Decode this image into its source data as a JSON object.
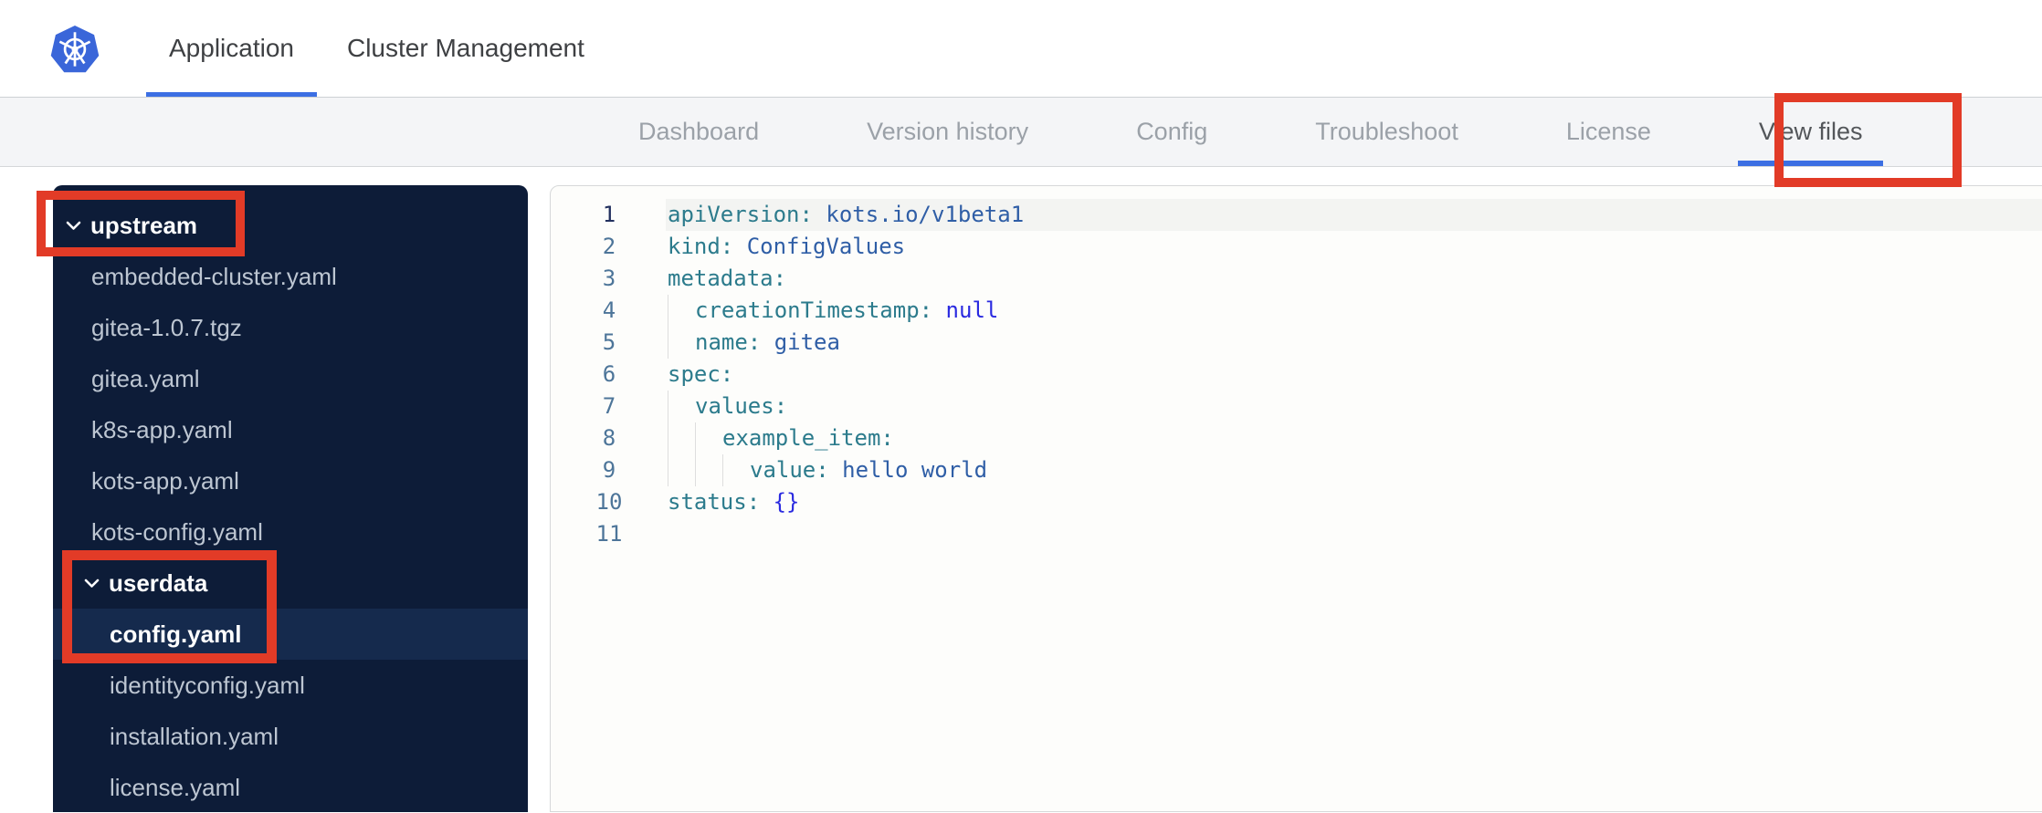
{
  "top_nav": {
    "tabs": [
      {
        "label": "Application",
        "active": true
      },
      {
        "label": "Cluster Management",
        "active": false
      }
    ]
  },
  "app_nav": {
    "tabs": [
      "Dashboard",
      "Version history",
      "Config",
      "Troubleshoot",
      "License",
      "View files"
    ],
    "active_tab": "View files"
  },
  "sidebar": {
    "items": [
      {
        "kind": "folder",
        "label": "upstream",
        "level": 0,
        "expanded": true
      },
      {
        "kind": "file",
        "label": "embedded-cluster.yaml",
        "level": 1
      },
      {
        "kind": "file",
        "label": "gitea-1.0.7.tgz",
        "level": 1
      },
      {
        "kind": "file",
        "label": "gitea.yaml",
        "level": 1
      },
      {
        "kind": "file",
        "label": "k8s-app.yaml",
        "level": 1
      },
      {
        "kind": "file",
        "label": "kots-app.yaml",
        "level": 1
      },
      {
        "kind": "file",
        "label": "kots-config.yaml",
        "level": 1
      },
      {
        "kind": "folder",
        "label": "userdata",
        "level": 1,
        "expanded": true
      },
      {
        "kind": "file",
        "label": "config.yaml",
        "level": 2,
        "selected": true
      },
      {
        "kind": "file",
        "label": "identityconfig.yaml",
        "level": 2
      },
      {
        "kind": "file",
        "label": "installation.yaml",
        "level": 2
      },
      {
        "kind": "file",
        "label": "license.yaml",
        "level": 2
      }
    ]
  },
  "editor": {
    "language": "yaml",
    "lines": [
      {
        "n": 1,
        "active": true,
        "indent": 0,
        "tokens": [
          [
            "key",
            "apiVersion:"
          ],
          [
            "sp",
            " "
          ],
          [
            "val",
            "kots.io/v1beta1"
          ]
        ]
      },
      {
        "n": 2,
        "indent": 0,
        "tokens": [
          [
            "key",
            "kind:"
          ],
          [
            "sp",
            " "
          ],
          [
            "val",
            "ConfigValues"
          ]
        ]
      },
      {
        "n": 3,
        "indent": 0,
        "tokens": [
          [
            "key",
            "metadata:"
          ]
        ]
      },
      {
        "n": 4,
        "indent": 1,
        "tokens": [
          [
            "key",
            "creationTimestamp:"
          ],
          [
            "sp",
            " "
          ],
          [
            "kw",
            "null"
          ]
        ]
      },
      {
        "n": 5,
        "indent": 1,
        "tokens": [
          [
            "key",
            "name:"
          ],
          [
            "sp",
            " "
          ],
          [
            "val",
            "gitea"
          ]
        ]
      },
      {
        "n": 6,
        "indent": 0,
        "tokens": [
          [
            "key",
            "spec:"
          ]
        ]
      },
      {
        "n": 7,
        "indent": 1,
        "tokens": [
          [
            "key",
            "values:"
          ]
        ]
      },
      {
        "n": 8,
        "indent": 2,
        "tokens": [
          [
            "key",
            "example_item:"
          ]
        ]
      },
      {
        "n": 9,
        "indent": 3,
        "tokens": [
          [
            "key",
            "value:"
          ],
          [
            "sp",
            " "
          ],
          [
            "val",
            "hello world"
          ]
        ]
      },
      {
        "n": 10,
        "indent": 0,
        "tokens": [
          [
            "key",
            "status:"
          ],
          [
            "sp",
            " "
          ],
          [
            "kw",
            "{}"
          ]
        ]
      },
      {
        "n": 11,
        "indent": 0,
        "tokens": []
      }
    ]
  },
  "icons": {
    "logo": "kubernetes-logo",
    "folder_chevron": "chevron-down-icon"
  },
  "annotations": {
    "color": "#e23b27",
    "boxes": [
      "view-files-tab",
      "upstream-folder",
      "userdata-config-file"
    ]
  },
  "colors": {
    "brand_blue": "#3a66d9",
    "active_underline": "#3c6fe3",
    "annotation_red": "#e23b27",
    "sidebar_bg": "#0d1c38",
    "sidebar_selected_bg": "#152a4d",
    "code_key": "#2c7b8c",
    "code_value": "#2f5ea6",
    "code_keyword": "#2a2ae0",
    "line_number": "#4d7599",
    "active_line_number": "#22305e"
  }
}
